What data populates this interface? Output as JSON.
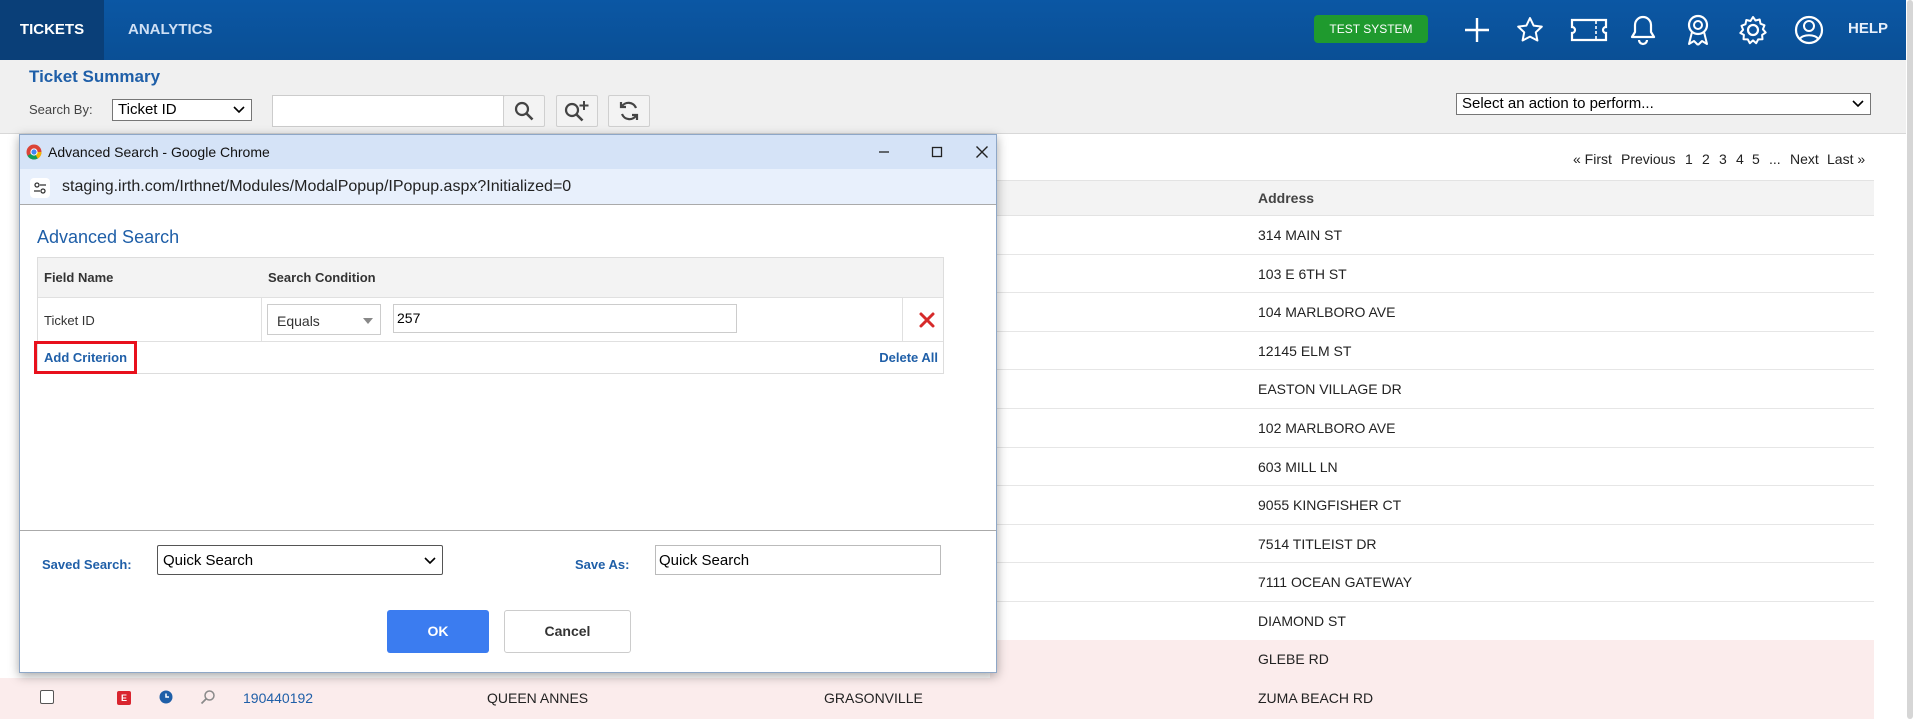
{
  "topnav": {
    "tabs": [
      {
        "label": "TICKETS"
      },
      {
        "label": "ANALYTICS"
      }
    ],
    "test_badge": "TEST SYSTEM",
    "icons": [
      "plus-icon",
      "star-icon",
      "ticket-icon",
      "bell-icon",
      "award-icon",
      "gear-icon",
      "user-icon"
    ],
    "help": "HELP"
  },
  "summary": {
    "title": "Ticket Summary",
    "search_by_label": "Search By:",
    "search_by_value": "Ticket ID",
    "search_value": "",
    "action_select": "Select an action to perform..."
  },
  "pager": {
    "first": "« First",
    "previous": "Previous",
    "current": "1",
    "pages": [
      "2",
      "3",
      "4",
      "5"
    ],
    "ellipsis": "...",
    "next": "Next",
    "last": "Last »"
  },
  "table": {
    "address_header": "Address",
    "addresses": [
      "314 MAIN ST",
      "103 E 6TH ST",
      "104 MARLBORO AVE",
      "12145 ELM ST",
      "EASTON VILLAGE DR",
      "102 MARLBORO AVE",
      "603 MILL LN",
      "9055 KINGFISHER CT",
      "7514 TITLEIST DR",
      "7111 OCEAN GATEWAY",
      "DIAMOND ST",
      "GLEBE RD"
    ],
    "last_row": {
      "badge": "E",
      "ticket": "190440192",
      "county": "QUEEN ANNES",
      "city": "GRASONVILLE",
      "address": "ZUMA BEACH RD"
    }
  },
  "popup": {
    "window_title": "Advanced Search - Google Chrome",
    "url": "staging.irth.com/Irthnet/Modules/ModalPopup/IPopup.aspx?Initialized=0",
    "heading": "Advanced Search",
    "col_field": "Field Name",
    "col_condition": "Search Condition",
    "criterion": {
      "field": "Ticket ID",
      "condition": "Equals",
      "value": "257"
    },
    "add_criterion": "Add Criterion",
    "delete_all": "Delete All",
    "saved_search_label": "Saved Search:",
    "saved_search_value": "Quick Search",
    "save_as_label": "Save As:",
    "save_as_value": "Quick Search",
    "ok": "OK",
    "cancel": "Cancel"
  },
  "colors": {
    "nav": "#0b57a4",
    "link": "#1f5fa8",
    "test_badge": "#1f9a2e",
    "ok_button": "#3b7cf0",
    "highlight": "#e8101c"
  }
}
